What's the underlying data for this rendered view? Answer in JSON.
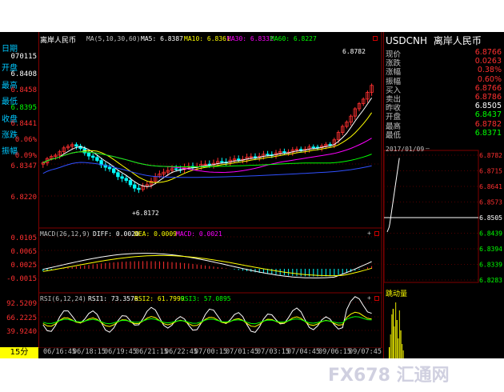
{
  "symbol_name": "离岸人民币",
  "symbol_code": "USDCNH",
  "left_info": [
    {
      "label": "日期",
      "value": "070115"
    },
    {
      "label": "开盘",
      "value": "6.8408"
    },
    {
      "label": "最高",
      "value": "6.8458"
    },
    {
      "label": "最低",
      "value": "6.8395"
    },
    {
      "label": "收盘",
      "value": "6.8441"
    },
    {
      "label": "涨跌",
      "value": "0.06%"
    },
    {
      "label": "振幅",
      "value": "0.09%"
    }
  ],
  "ma_header": {
    "title": "MA(5,10,30,60)",
    "ma5": "MA5: 6.8387",
    "ma10": "MA10: 6.8361",
    "ma30": "MA30: 6.8332",
    "ma60": "MA60: 6.8227"
  },
  "macd_header": {
    "title": "MACD(26,12,9)",
    "diff": "DIFF: 0.0020",
    "dea": "DEA: 0.0009",
    "macd": "MACD: 0.0021"
  },
  "rsi_header": {
    "title": "RSI(6,12,24)",
    "rsi1": "RSI1: 73.3576",
    "rsi2": "RSI2: 61.7999",
    "rsi3": "RSI3: 57.0895"
  },
  "price_axis": [
    "6.8347",
    "6.8220"
  ],
  "macd_axis": [
    "0.0105",
    "0.0065",
    "0.0025",
    "-0.0015"
  ],
  "rsi_axis": [
    "92.5209",
    "66.2225",
    "39.9240"
  ],
  "annotations": {
    "high": "6.8782",
    "low": "+6.8172"
  },
  "time_labels": [
    "06/16:45",
    "06/18:15",
    "06/19:45",
    "06/21:15",
    "06/22:45",
    "07/00:15",
    "07/01:45",
    "07/03:15",
    "07/04:45",
    "09/06:15",
    "09/07:45"
  ],
  "period_label": "15分",
  "quote_rows": [
    {
      "k": "现价",
      "v": "6.8766"
    },
    {
      "k": "涨跌",
      "v": "0.0263"
    },
    {
      "k": "涨幅",
      "v": "0.38%"
    },
    {
      "k": "振幅",
      "v": "0.60%"
    },
    {
      "k": "买入",
      "v": "6.8766"
    },
    {
      "k": "卖出",
      "v": "6.8786"
    },
    {
      "k": "昨收",
      "v": "6.8505"
    },
    {
      "k": "开盘",
      "v": "6.8437"
    },
    {
      "k": "最高",
      "v": "6.8782"
    },
    {
      "k": "最低",
      "v": "6.8371"
    }
  ],
  "mini_date": "2017/01/09",
  "mini_axis": [
    "6.8782",
    "6.8715",
    "6.8641",
    "6.8573",
    "6.8505",
    "6.8439",
    "6.8394",
    "6.8339",
    "6.8283"
  ],
  "volume_label": "跳动量",
  "watermark": "FX678 汇通网",
  "colors": {
    "up": "#ff3030",
    "down": "#00ffff",
    "ma5": "#ffffff",
    "ma10": "#ffff00",
    "ma30": "#ff00ff",
    "ma60": "#00ff00",
    "label": "#00c8ff"
  }
}
